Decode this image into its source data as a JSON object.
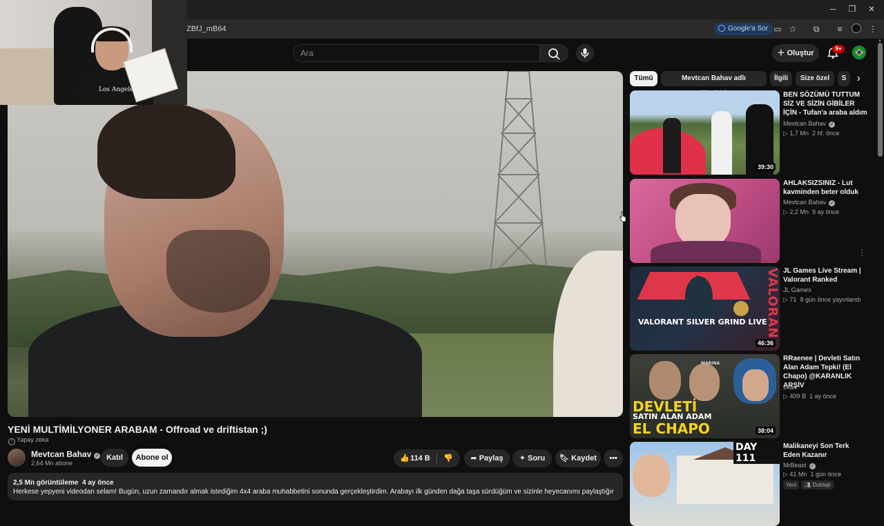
{
  "browser": {
    "url_fragment": "ZBfJ_mB64",
    "google_ask_label": "Google'a Sor"
  },
  "header": {
    "search_placeholder": "Ara",
    "create_label": "Oluştur",
    "notification_count": "9+"
  },
  "webcam": {
    "shirt_text": "Los Angeles"
  },
  "video": {
    "title": "YENİ MULTİMİLYONER ARABAM - Offroad ve driftistan ;)",
    "ai_label": "Yapay zeka",
    "channel_name": "Mevtcan Bahav",
    "subscribers": "2,64 Mn abone",
    "join_label": "Katıl",
    "subscribe_label": "Abone ol",
    "likes": "114 B",
    "share_label": "Paylaş",
    "ask_label": "Soru",
    "save_label": "Kaydet",
    "views": "2,5 Mn görüntüleme",
    "age": "4 ay önce",
    "description": "Herkese yepyeni videodan selam! Bugün, uzun zamandır almak istediğim 4x4 araba muhabbetini sonunda gerçekleştirdim. Arabayı ilk günden dağa taşa sürdüğüm ve sizinle heyecanımı paylaştığım bu videoyu"
  },
  "chips": [
    "Tümü",
    "Mevtcan Bahav adlı yükleyiciden",
    "İlgili",
    "Size özel",
    "S"
  ],
  "recommendations": [
    {
      "title": "BEN SÖZÜMÜ TUTTUM SİZ VE SİZİN GİBİLER İÇİN - Tufan'a araba aldım",
      "channel": "Mevtcan Bahav",
      "views": "1,7 Mn",
      "age": "2 hf. önce",
      "duration": "39:30"
    },
    {
      "title": "AHLAKSIZSINIZ - Lut kavminden beter olduk",
      "channel": "Mevtcan Bahav",
      "views": "2,2 Mn",
      "age": "9 ay önce",
      "duration": ""
    },
    {
      "title": "JL Games Live Stream | Valorant Ranked",
      "channel": "JL Games",
      "views": "71",
      "age": "8 gün önce yayınlandı",
      "duration": "46:36",
      "thumb_text": "VALORANT SILVER GRIND LIVE",
      "thumb_side": "VALORAN"
    },
    {
      "title": "RRaenee | Devleti Satın Alan Adam Tepki! (El Chapo) @KARANLIK ARŞİV",
      "channel": "2kan",
      "views": "409 B",
      "age": "1 ay önce",
      "duration": "38:04",
      "thumb_line1": "DEVLETİ",
      "thumb_line2": "SATIN ALAN ADAM",
      "thumb_line3": "EL CHAPO",
      "thumb_small": "MARINA"
    },
    {
      "title": "Malikaneyi Son Terk Eden Kazanır",
      "channel": "MrBeast",
      "views": "41 Mn",
      "age": "1 gün önce",
      "tag_new": "Yeni",
      "tag_dubbed": "Dublajlı",
      "thumb_text": "DAY 111"
    }
  ]
}
